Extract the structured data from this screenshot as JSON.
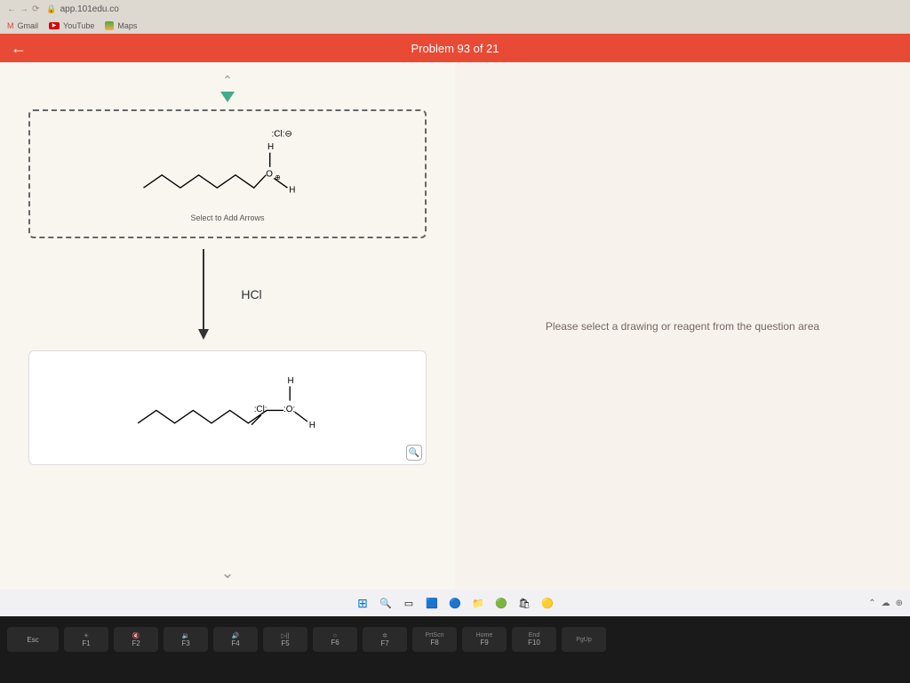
{
  "browser": {
    "url": "app.101edu.co",
    "bookmarks": {
      "gmail": "Gmail",
      "youtube": "YouTube",
      "maps": "Maps"
    }
  },
  "header": {
    "problem_title": "Problem 93 of 21"
  },
  "left_panel": {
    "reagent_labels": {
      "cl": ":Cl:⊖",
      "h_top": "H",
      "o_plus": "⊕",
      "h_right": "H"
    },
    "add_arrows_text": "Select to Add Arrows",
    "reaction_label": "HCl",
    "product_labels": {
      "cl": ":Cl:",
      "h_top": "H",
      "o": ":O:",
      "h_right": "H"
    }
  },
  "right_panel": {
    "instruction": "Please select a drawing or reagent from the question area"
  },
  "keyboard": {
    "esc": "Esc",
    "f1_top": "☀",
    "f1": "F1",
    "f2_top": "🔇",
    "f2": "F2",
    "f3_top": "🔉",
    "f3": "F3",
    "f4_top": "🔊",
    "f4": "F4",
    "f5_top": "▷||",
    "f5": "F5",
    "f6_top": "☼",
    "f6": "F6",
    "f7_top": "✲",
    "f7": "F7",
    "f8_top": "PrtScn",
    "f8": "F8",
    "f9_top": "Home",
    "f9": "F9",
    "f10_top": "End",
    "f10": "F10",
    "f11_top": "PgUp",
    "row2": {
      "at": "@",
      "hash": "#",
      "dollar": "$",
      "percent": "%",
      "caret": "^",
      "amp": "&",
      "star": "*",
      "lparen": "(",
      "rparen": ")",
      "dash": "—"
    }
  }
}
